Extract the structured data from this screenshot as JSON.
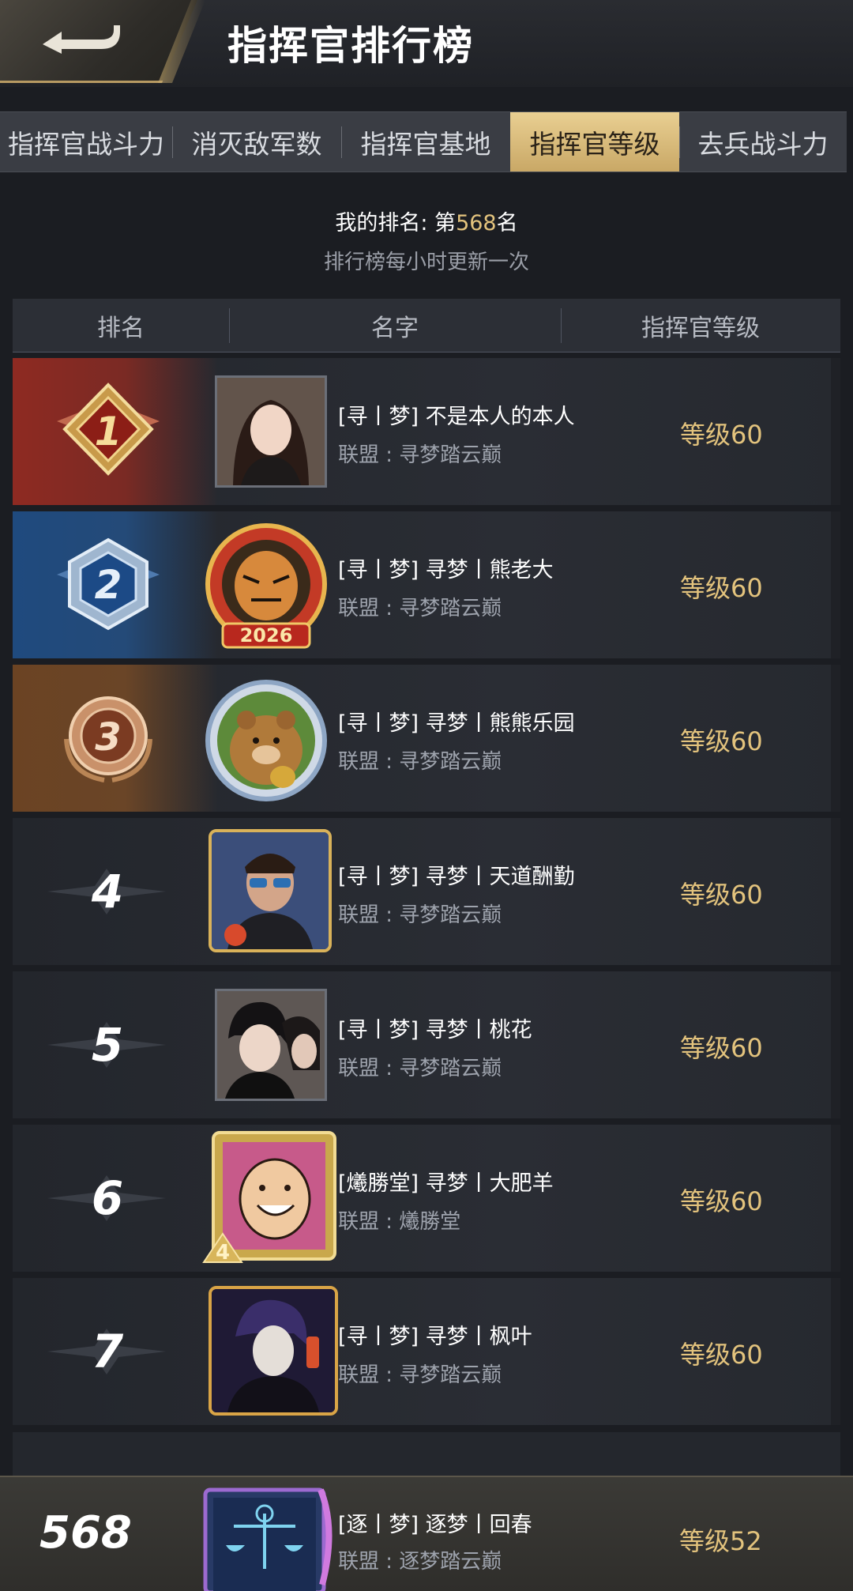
{
  "header": {
    "title": "指挥官排行榜"
  },
  "tabs": [
    {
      "label": "指挥官战斗力",
      "active": false
    },
    {
      "label": "消灭敌军数",
      "active": false
    },
    {
      "label": "指挥官基地",
      "active": false
    },
    {
      "label": "指挥官等级",
      "active": true
    },
    {
      "label": "去兵战斗力",
      "active": false
    }
  ],
  "info": {
    "my_rank_prefix": "我的排名: 第",
    "my_rank_value": "568",
    "my_rank_suffix": "名",
    "update_note": "排行榜每小时更新一次"
  },
  "columns": {
    "rank": "排名",
    "name": "名字",
    "level": "指挥官等级"
  },
  "rows": [
    {
      "rank": "1",
      "name": "[寻丨梦] 不是本人的本人",
      "alliance": "联盟 : 寻梦踏云巅",
      "level": "等级60"
    },
    {
      "rank": "2",
      "name": "[寻丨梦] 寻梦丨熊老大",
      "alliance": "联盟 : 寻梦踏云巅",
      "level": "等级60",
      "avatar_badge": "2026"
    },
    {
      "rank": "3",
      "name": "[寻丨梦] 寻梦丨熊熊乐园",
      "alliance": "联盟 : 寻梦踏云巅",
      "level": "等级60"
    },
    {
      "rank": "4",
      "name": "[寻丨梦] 寻梦丨天道酬勤",
      "alliance": "联盟 : 寻梦踏云巅",
      "level": "等级60"
    },
    {
      "rank": "5",
      "name": "[寻丨梦] 寻梦丨桃花",
      "alliance": "联盟 : 寻梦踏云巅",
      "level": "等级60"
    },
    {
      "rank": "6",
      "name": "[爔勝堂] 寻梦丨大肥羊",
      "alliance": "联盟 : 爔勝堂",
      "level": "等级60",
      "avatar_badge": "4"
    },
    {
      "rank": "7",
      "name": "[寻丨梦] 寻梦丨枫叶",
      "alliance": "联盟 : 寻梦踏云巅",
      "level": "等级60"
    }
  ],
  "self": {
    "rank": "568",
    "name": "[逐丨梦] 逐梦丨回春",
    "alliance": "联盟 : 逐梦踏云巅",
    "level": "等级52"
  }
}
